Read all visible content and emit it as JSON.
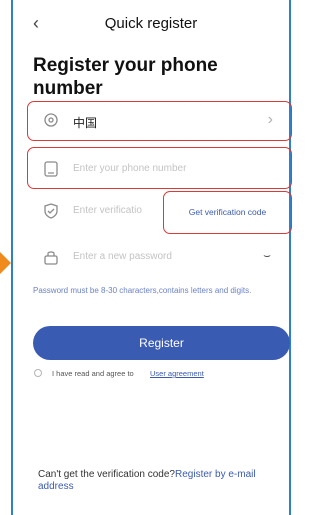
{
  "header": {
    "title": "Quick register"
  },
  "page_title": "Register your phone number",
  "country": {
    "value": "中国"
  },
  "phone": {
    "placeholder": "Enter your phone number"
  },
  "code": {
    "placeholder": "Enter verificatio",
    "button_label": "Get verification code"
  },
  "password": {
    "placeholder": "Enter a new password"
  },
  "hint": "Password must be 8-30 characters,contains letters and digits.",
  "register_label": "Register",
  "agreement": {
    "text": "I have read and agree to",
    "link": "User agreement"
  },
  "bottom": {
    "text": "Can't get the verification code?",
    "link": "Register by e-mail address"
  },
  "colors": {
    "accent": "#3a5bb2",
    "highlight": "#d93a3a",
    "frame": "#2f80c9",
    "arrow": "#f08a1c"
  }
}
